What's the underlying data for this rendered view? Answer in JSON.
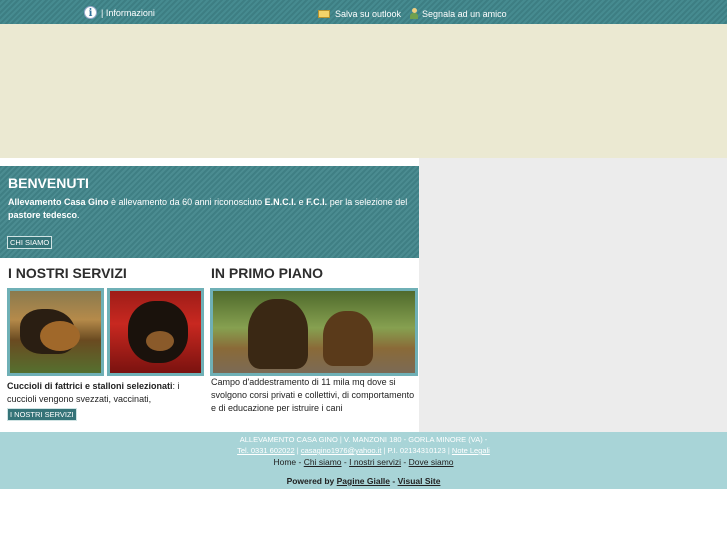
{
  "topbar": {
    "info_label": "| Informazioni",
    "outlook_label": "Salva su outlook",
    "friend_label": "Segnala ad un amico"
  },
  "welcome": {
    "title": "BENVENUTI",
    "text_part1": "Allevamento Casa Gino",
    "text_part2": " è allevamento da 60 anni riconosciuto ",
    "text_part3": "E.N.C.I.",
    "text_part4": " e ",
    "text_part5": "F.C.I.",
    "text_part6": " per la selezione del ",
    "text_part7": "pastore tedesco",
    "text_part8": ".",
    "button": "CHI SIAMO"
  },
  "services": {
    "title": "I NOSTRI SERVIZI",
    "desc_bold": "Cuccioli di fattrici e stalloni selezionati",
    "desc_rest": ": i cuccioli vengono svezzati, vaccinati,",
    "button": "I NOSTRI SERVIZI"
  },
  "featured": {
    "title": "IN PRIMO PIANO",
    "desc": "Campo d'addestramento di 11 mila mq dove si svolgono corsi privati e collettivi, di comportamento e di educazione per istruire i cani"
  },
  "footer": {
    "line1": "ALLEVAMENTO CASA GINO | V. MANZONI 180 - GORLA MINORE (VA) -",
    "tel": "Tel. 0331 602022",
    "sep1": " | ",
    "email": "casagino1976@yahoo.it",
    "piva": " | P.I. 02134310123 | ",
    "legal": "Note Legali",
    "nav": {
      "home": "Home",
      "sep": " - ",
      "chi_siamo": "Chi siamo",
      "servizi": "I nostri servizi",
      "dove": "Dove siamo"
    },
    "powered_label": "Powered by ",
    "pagine_gialle": "Pagine Gialle",
    "dash": " - ",
    "visual_site": "Visual Site"
  }
}
